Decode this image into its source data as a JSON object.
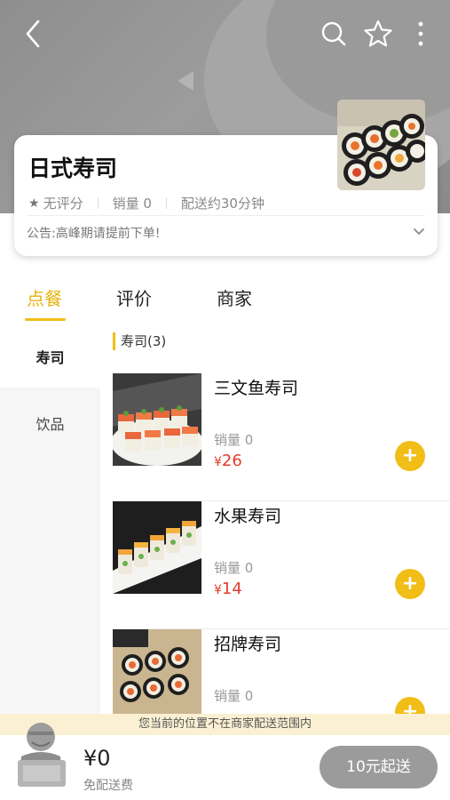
{
  "shop": {
    "name": "日式寿司",
    "rating": "无评分",
    "sales": "销量 0",
    "delivery": "配送约30分钟",
    "notice": "公告:高峰期请提前下单!"
  },
  "tabs": [
    "点餐",
    "评价",
    "商家"
  ],
  "categories": [
    "寿司",
    "饮品"
  ],
  "section": "寿司(3)",
  "items": [
    {
      "name": "三文鱼寿司",
      "sales": "销量 0",
      "price": "26"
    },
    {
      "name": "水果寿司",
      "sales": "销量 0",
      "price": "14"
    },
    {
      "name": "招牌寿司",
      "sales": "销量 0",
      "price": ""
    }
  ],
  "currency": "¥",
  "add_label": "+",
  "cart": {
    "warning": "您当前的位置不在商家配送范围内",
    "total": "¥0",
    "fee": "免配送费",
    "checkout": "10元起送"
  },
  "icons": [
    "back-icon",
    "search-icon",
    "star-icon",
    "more-icon",
    "chevron-down-icon"
  ],
  "colors": {
    "accent": "#f1be17",
    "price": "#e23b2d",
    "checkout": "#9b9b9b"
  }
}
